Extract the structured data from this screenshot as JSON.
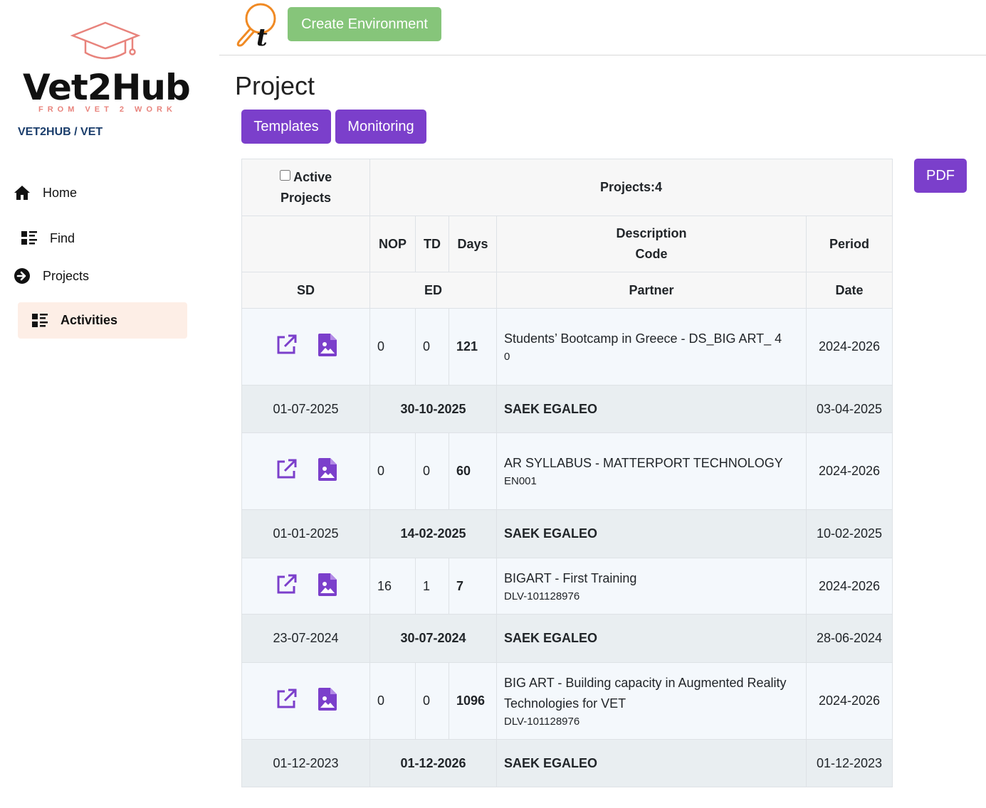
{
  "sidebar": {
    "logo_text": "Vet2Hub",
    "logo_sub": "FROM VET 2 WORK",
    "breadcrumb": "VET2HUB / VET",
    "items": [
      {
        "label": "Home",
        "icon": "home-icon"
      },
      {
        "label": "Find",
        "icon": "list-icon"
      },
      {
        "label": "Projects",
        "icon": "arrow-circle-right-icon"
      },
      {
        "label": "Activities",
        "icon": "list-icon",
        "active": true
      }
    ]
  },
  "topbar": {
    "create_label": "Create Environment"
  },
  "page": {
    "title": "Project",
    "templates_label": "Templates",
    "monitoring_label": "Monitoring",
    "pdf_label": "PDF"
  },
  "table": {
    "active_label": "Active",
    "projects_label": "Projects",
    "count_label": "Projects:4",
    "headers": {
      "nop": "NOP",
      "td": "TD",
      "days": "Days",
      "description": "Description",
      "code": "Code",
      "period": "Period",
      "sd": "SD",
      "ed": "ED",
      "partner": "Partner",
      "date": "Date"
    },
    "rows": [
      {
        "nop": "0",
        "td": "0",
        "days": "121",
        "description": "Students’ Bootcamp in Greece - DS_BIG ART_ 4",
        "code": "0",
        "period": "2024-2026",
        "sd": "01-07-2025",
        "ed": "30-10-2025",
        "partner": "SAEK EGALEO",
        "date": "03-04-2025"
      },
      {
        "nop": "0",
        "td": "0",
        "days": "60",
        "description": "AR SYLLABUS - MATTERPORT TECHNOLOGY",
        "code": "EN001",
        "period": "2024-2026",
        "sd": "01-01-2025",
        "ed": "14-02-2025",
        "partner": "SAEK EGALEO",
        "date": "10-02-2025"
      },
      {
        "nop": "16",
        "td": "1",
        "days": "7",
        "description": "BIGART - First Training",
        "code": "DLV-101128976",
        "period": "2024-2026",
        "sd": "23-07-2024",
        "ed": "30-07-2024",
        "partner": "SAEK EGALEO",
        "date": "28-06-2024"
      },
      {
        "nop": "0",
        "td": "0",
        "days": "1096",
        "description": "BIG ART - Building capacity in Augmented Reality Technologies for VET",
        "code": "DLV-101128976",
        "period": "2024-2026",
        "sd": "01-12-2023",
        "ed": "01-12-2026",
        "partner": "SAEK EGALEO",
        "date": "01-12-2023"
      }
    ]
  },
  "colors": {
    "purple": "#7b3fcb",
    "green": "#86c57a",
    "logo_accent": "#e8837c",
    "active_bg": "#fdeee6"
  }
}
